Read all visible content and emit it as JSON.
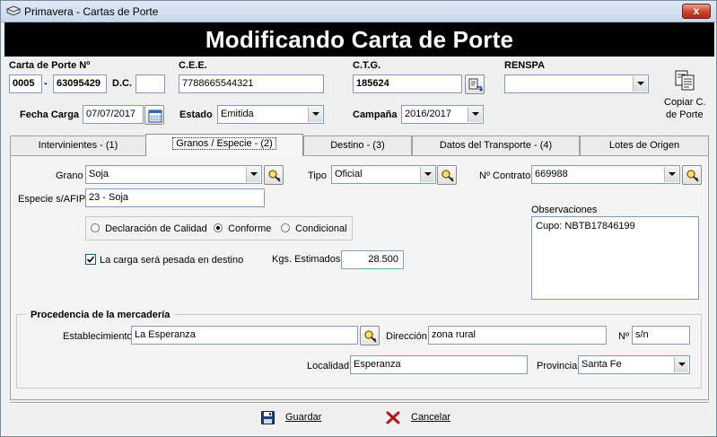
{
  "window": {
    "title": "Primavera - Cartas de Porte",
    "close_label": "x",
    "banner": "Modificando Carta de Porte"
  },
  "header": {
    "carta_label": "Carta de Porte Nº",
    "carta_prefix": "0005",
    "carta_dash": "-",
    "carta_number": "63095429",
    "dc_label": "D.C.",
    "dc_value": "",
    "cee_label": "C.E.E.",
    "cee_value": "7788665544321",
    "ctg_label": "C.T.G.",
    "ctg_value": "185624",
    "renspa_label": "RENSPA",
    "renspa_value": "",
    "fecha_label": "Fecha Carga",
    "fecha_value": "07/07/2017",
    "estado_label": "Estado",
    "estado_value": "Emitida",
    "campana_label": "Campaña",
    "campana_value": "2016/2017",
    "copiar_label_1": "Copiar C.",
    "copiar_label_2": "de Porte"
  },
  "tabs": [
    {
      "label": "Intervinientes - (1)",
      "active": false
    },
    {
      "label": "Granos / Especie - (2)",
      "active": true
    },
    {
      "label": "Destino - (3)",
      "active": false
    },
    {
      "label": "Datos del Transporte - (4)",
      "active": false
    },
    {
      "label": "Lotes de Origen",
      "active": false
    }
  ],
  "granos": {
    "grano_label": "Grano",
    "grano_value": "Soja",
    "tipo_label": "Tipo",
    "tipo_value": "Oficial",
    "contrato_label": "Nº Contrato",
    "contrato_value": "669988",
    "especie_label": "Especie s/AFIP",
    "especie_value": "23 - Soja",
    "calidad_options": [
      "Declaración de Calidad",
      "Conforme",
      "Condicional"
    ],
    "calidad_selected": "Conforme",
    "pesada_label": "La carga será pesada en destino",
    "pesada_checked": true,
    "kgs_label": "Kgs. Estimados",
    "kgs_value": "28.500",
    "obs_label": "Observaciones",
    "obs_value": "Cupo: NBTB17846199"
  },
  "procedencia": {
    "title": "Procedencia de la mercadería",
    "establecimiento_label": "Establecimiento",
    "establecimiento_value": "La Esperanza",
    "direccion_label": "Dirección",
    "direccion_value": "zona rural",
    "numero_label": "Nº",
    "numero_value": "s/n",
    "localidad_label": "Localidad",
    "localidad_value": "Esperanza",
    "provincia_label": "Provincia",
    "provincia_value": "Santa Fe"
  },
  "actions": {
    "guardar": "Guardar",
    "cancelar": "Cancelar"
  },
  "colors": {
    "banner_bg": "#000000",
    "banner_fg": "#ffffff",
    "close_red": "#c9432d",
    "field_border": "#7f9db9"
  },
  "icons": [
    "app-icon",
    "close-icon",
    "ctg-lookup-icon",
    "copy-document-icon",
    "calendar-icon",
    "search-key-icon",
    "dropdown-arrow-icon",
    "save-disk-icon",
    "cancel-x-icon"
  ]
}
